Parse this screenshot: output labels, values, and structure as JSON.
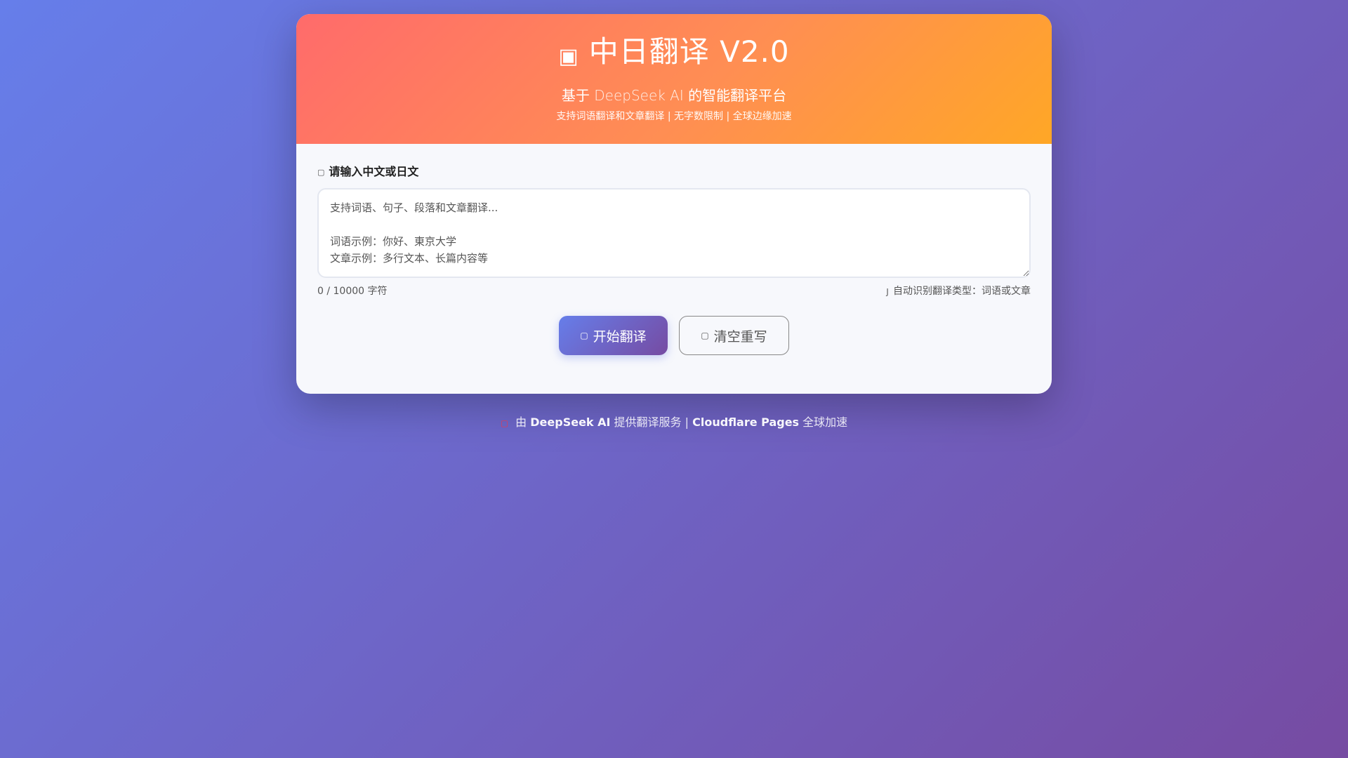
{
  "header": {
    "title_icon": "translate-icon",
    "title": "中日翻译 V2.0",
    "subtitle_prefix": "基于 ",
    "subtitle_brand": "DeepSeek AI",
    "subtitle_suffix": " 的智能翻译平台",
    "features": "支持词语翻译和文章翻译 | 无字数限制 | 全球边缘加速"
  },
  "input": {
    "label_icon": "pen-icon",
    "label": "请输入中文或日文",
    "value": "",
    "placeholder": "支持词语、句子、段落和文章翻译...\n\n词语示例：你好、東京大学\n文章示例：多行文本、长篇内容等",
    "counter": "0 / 10000 字符",
    "hint_icon": "lightbulb-icon",
    "hint": "自动识别翻译类型：词语或文章"
  },
  "actions": {
    "translate_icon": "rocket-icon",
    "translate_label": "开始翻译",
    "clear_icon": "trash-icon",
    "clear_label": "清空重写"
  },
  "footer": {
    "icon": "heart-icon",
    "prefix": "由 ",
    "brand1": "DeepSeek AI",
    "middle": " 提供翻译服务 | ",
    "brand2": "Cloudflare Pages",
    "suffix": " 全球加速"
  },
  "colors": {
    "background_start": "#667eea",
    "background_end": "#764ba2",
    "header_start": "#ff6b6b",
    "header_end": "#ffa726",
    "heart": "#e53950"
  }
}
